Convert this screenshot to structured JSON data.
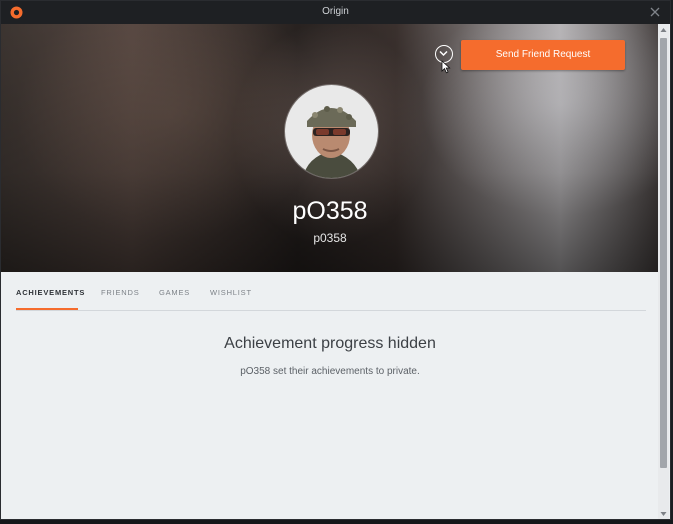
{
  "window": {
    "title": "Origin"
  },
  "profile": {
    "display_name": "pO358",
    "username": "p0358",
    "send_friend_request_label": "Send Friend Request"
  },
  "tabs": [
    {
      "label": "ACHIEVEMENTS",
      "active": true
    },
    {
      "label": "FRIENDS",
      "active": false
    },
    {
      "label": "GAMES",
      "active": false
    },
    {
      "label": "WISHLIST",
      "active": false
    }
  ],
  "achievements": {
    "heading": "Achievement progress hidden",
    "message": "pO358 set their achievements to private."
  },
  "colors": {
    "accent": "#f56c2d",
    "titlebar": "#1e2023",
    "content_bg": "#edf0f2"
  },
  "icons": {
    "app": "origin-logo-icon",
    "close": "close-icon",
    "more": "chevron-down-circle-icon",
    "cursor": "mouse-pointer-icon"
  }
}
